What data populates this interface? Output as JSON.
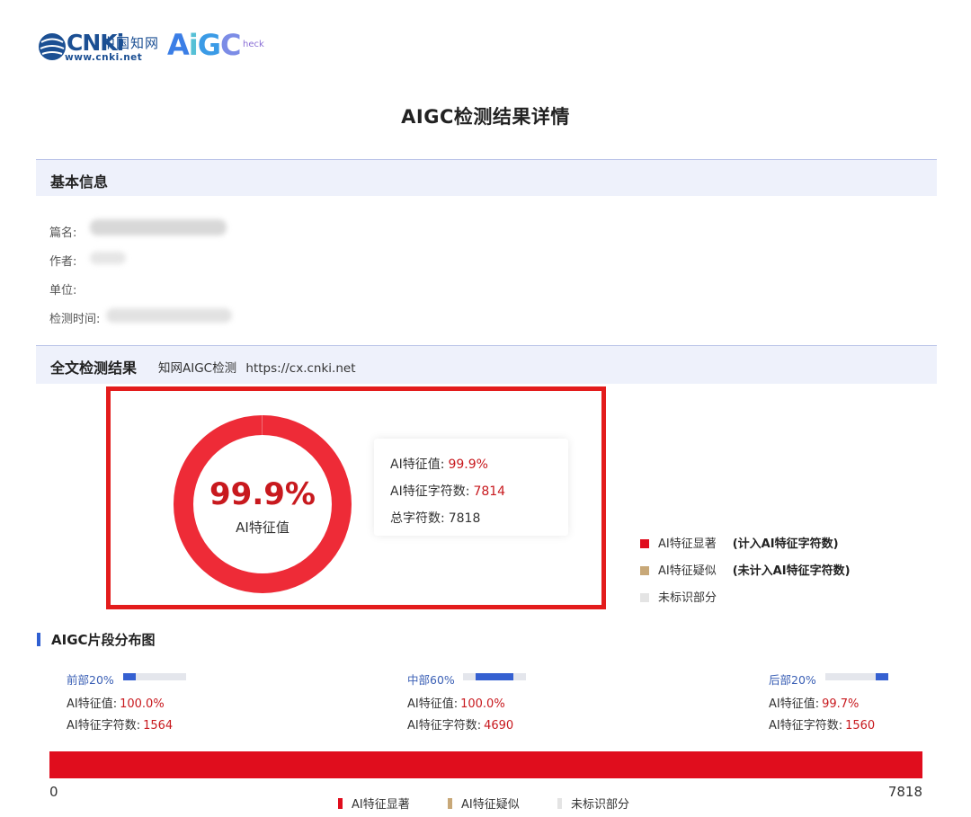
{
  "logo": {
    "cnki_text": "CNKi",
    "cnki_cn": "中国知网",
    "cnki_url": "www.cnki.net",
    "aigc_text": "AIGC",
    "aigc_sub": "heck"
  },
  "title": "AIGC检测结果详情",
  "basic_info": {
    "heading": "基本信息",
    "fields": [
      {
        "label": "篇名:"
      },
      {
        "label": "作者:"
      },
      {
        "label": "单位:"
      },
      {
        "label": "检测时间:"
      }
    ]
  },
  "full_result": {
    "heading": "全文检测结果",
    "source": "知网AIGC检测",
    "url": "https://cx.cnki.net",
    "donut_value": "99.9%",
    "donut_fraction": 0.999,
    "donut_label": "AI特征值",
    "stats": [
      {
        "label": "AI特征值:",
        "value": "99.9%"
      },
      {
        "label": "AI特征字符数:",
        "value": "7814"
      },
      {
        "label": "总字符数:",
        "value": "7818"
      }
    ],
    "legend": [
      {
        "label": "AI特征显著",
        "note": "(计入AI特征字符数)",
        "color": "#e00d1d"
      },
      {
        "label": "AI特征疑似",
        "note": "(未计入AI特征字符数)",
        "color": "#c8a878"
      },
      {
        "label": "未标识部分",
        "note": "",
        "color": "#e4e4e4"
      }
    ]
  },
  "distribution": {
    "heading": "AIGC片段分布图",
    "segments": [
      {
        "name": "前部20%",
        "ai_label": "AI特征值:",
        "ai_value": "100.0%",
        "chars_label": "AI特征字符数:",
        "chars_value": "1564",
        "bar_fill": 0.2,
        "bar_offset": 0.0
      },
      {
        "name": "中部60%",
        "ai_label": "AI特征值:",
        "ai_value": "100.0%",
        "chars_label": "AI特征字符数:",
        "chars_value": "4690",
        "bar_fill": 0.6,
        "bar_offset": 0.2
      },
      {
        "name": "后部20%",
        "ai_label": "AI特征值:",
        "ai_value": "99.7%",
        "chars_label": "AI特征字符数:",
        "chars_value": "1560",
        "bar_fill": 0.2,
        "bar_offset": 0.8
      }
    ],
    "axis_min": "0",
    "axis_max": "7818",
    "legend": [
      {
        "label": "AI特征显著",
        "color": "#e00d1d"
      },
      {
        "label": "AI特征疑似",
        "color": "#c8a878"
      },
      {
        "label": "未标识部分",
        "color": "#e4e4e4"
      }
    ]
  }
}
